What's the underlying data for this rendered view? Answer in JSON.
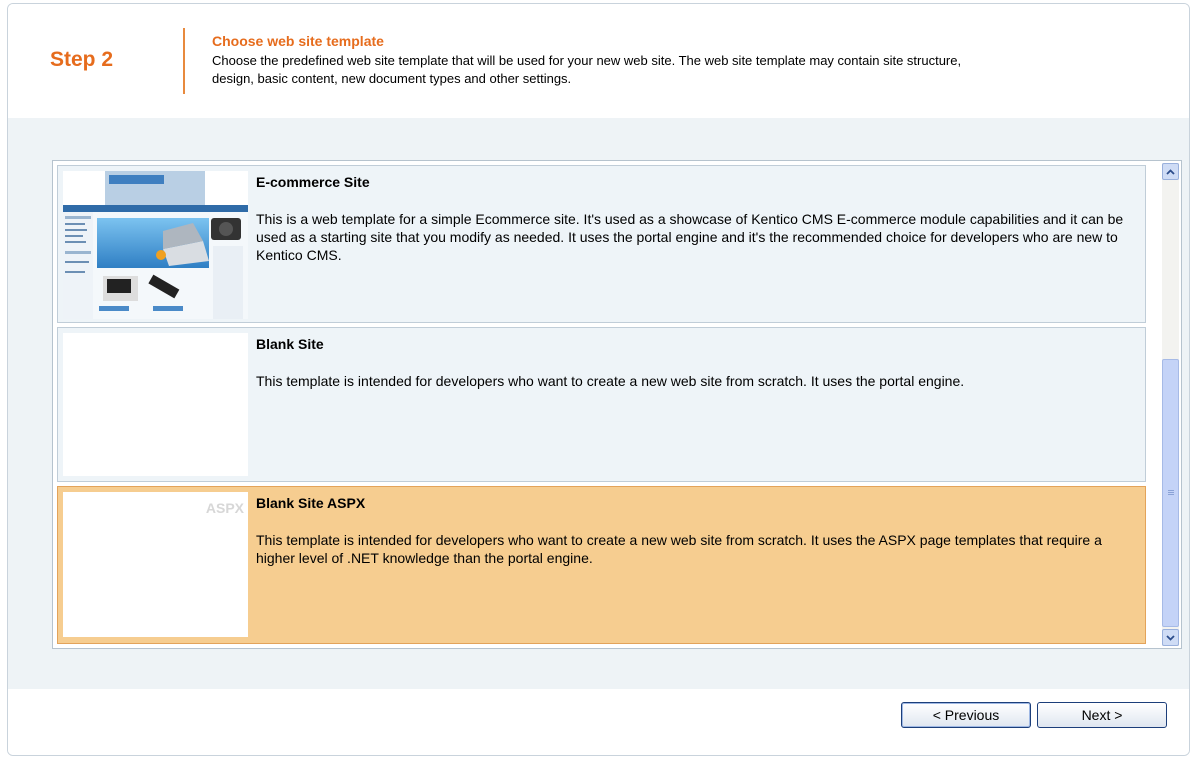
{
  "header": {
    "step_label": "Step 2",
    "title": "Choose web site template",
    "description": "Choose the predefined web site template that will be used for your new web site. The web site template may contain site structure, design, basic content, new document types and other settings."
  },
  "templates": [
    {
      "title": "E-commerce Site",
      "description": "This is a web template for a simple Ecommerce site. It's used as a showcase of Kentico CMS E-commerce module capabilities and it can be used as a starting site that you modify as needed. It uses the portal engine and it's the recommended choice for developers who are new to Kentico CMS.",
      "thumbnail_text": "Special offer of notebooks",
      "thumbnail_logo": "Ecommerce"
    },
    {
      "title": "Blank Site",
      "description": "This template is intended for developers who want to create a new web site from scratch. It uses the portal engine."
    },
    {
      "title": "Blank Site ASPX",
      "description": "This template is intended for developers who want to create a new web site from scratch. It uses the ASPX page templates that require a higher level of .NET knowledge than the portal engine.",
      "thumbnail_label": "ASPX",
      "selected": true
    }
  ],
  "footer": {
    "previous_label": "< Previous",
    "next_label": "Next >"
  },
  "colors": {
    "accent": "#e66c1d",
    "selected_bg": "#f6cd90",
    "item_bg": "#eef4f8"
  }
}
